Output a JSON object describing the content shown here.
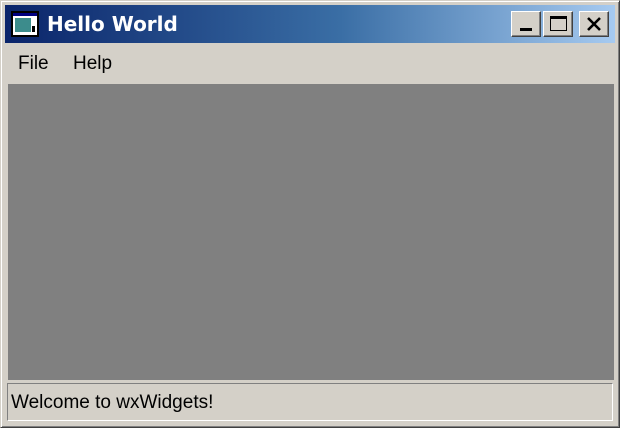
{
  "window": {
    "title": "Hello World",
    "icon": "app-window-icon",
    "controls": {
      "minimize_icon": "minimize-icon",
      "maximize_icon": "maximize-icon",
      "close_icon": "close-icon"
    }
  },
  "menubar": {
    "items": [
      {
        "label": "File"
      },
      {
        "label": "Help"
      }
    ]
  },
  "statusbar": {
    "text": "Welcome to wxWidgets!"
  },
  "colors": {
    "titlebar_start": "#0a246a",
    "titlebar_end": "#a6caf0",
    "client_area": "#808080",
    "window_face": "#d4d0c8"
  }
}
